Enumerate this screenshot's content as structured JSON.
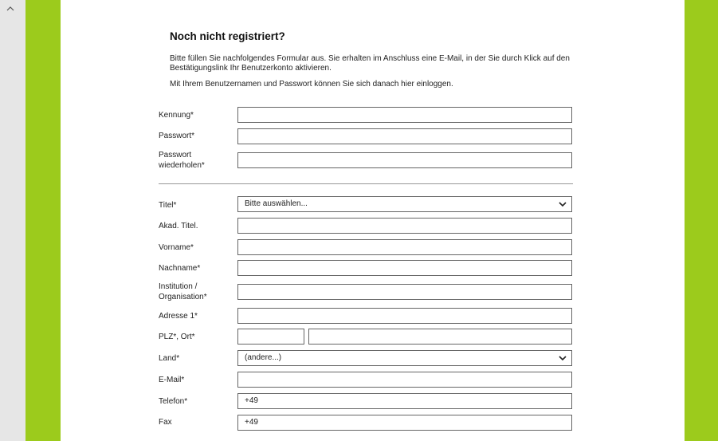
{
  "form": {
    "heading": "Noch nicht registriert?",
    "intro_line": "Bitte füllen Sie nachfolgendes Formular aus. Sie erhalten im Anschluss eine E-Mail, in der Sie durch Klick auf den Bestätigungslink Ihr Benutzerkonto aktivieren.",
    "login_hint": "Mit Ihrem Benutzernamen und Passwort können Sie sich danach hier einloggen.",
    "fields": {
      "kennung": {
        "label": "Kennung*",
        "value": ""
      },
      "passwort": {
        "label": "Passwort*",
        "value": ""
      },
      "passwort_wdh": {
        "label_line1": "Passwort",
        "label_line2": "wiederholen*",
        "value": ""
      },
      "titel": {
        "label": "Titel*",
        "value": "Bitte auswählen..."
      },
      "akad_titel": {
        "label": "Akad. Titel.",
        "value": ""
      },
      "vorname": {
        "label": "Vorname*",
        "value": ""
      },
      "nachname": {
        "label": "Nachname*",
        "value": ""
      },
      "institution": {
        "label_line1": "Institution /",
        "label_line2": "Organisation*",
        "value": ""
      },
      "adresse1": {
        "label": "Adresse 1*",
        "value": ""
      },
      "plz_ort": {
        "label": "PLZ*, Ort*",
        "plz_value": "",
        "ort_value": ""
      },
      "land": {
        "label": "Land*",
        "value": "(andere...)"
      },
      "email": {
        "label": "E-Mail*",
        "value": ""
      },
      "telefon": {
        "label": "Telefon*",
        "value": "+49"
      },
      "fax": {
        "label": "Fax",
        "value": "+49"
      }
    }
  },
  "colors": {
    "accent_green": "#9ccb1c",
    "field_border": "#666666"
  }
}
